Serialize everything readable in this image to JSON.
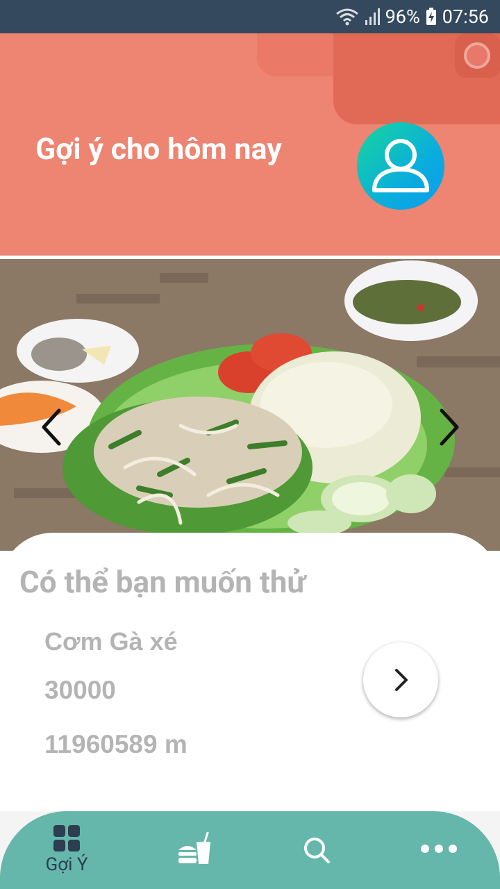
{
  "status_bar": {
    "battery": "96%",
    "time": "07:56",
    "background": "#34495e"
  },
  "header": {
    "title": "Gợi ý cho hôm nay",
    "background": "#ee8472",
    "avatar_icon": "user-icon"
  },
  "carousel": {
    "image_description": "Cơm Gà xé",
    "prev_icon": "chevron-left-icon",
    "next_icon": "chevron-right-icon"
  },
  "suggestion": {
    "section_title": "Có thể bạn muốn thử",
    "dish_name": "Cơm Gà xé",
    "price": "30000",
    "distance": "11960589 m",
    "detail_icon": "chevron-right-icon"
  },
  "bottom_nav": {
    "background": "#65b7ac",
    "items": [
      {
        "label": "Gợi Ý",
        "icon": "grid-icon",
        "active": true
      },
      {
        "label": "",
        "icon": "burger-drink-icon"
      },
      {
        "label": "",
        "icon": "search-icon"
      },
      {
        "label": "",
        "icon": "more-icon"
      }
    ]
  }
}
